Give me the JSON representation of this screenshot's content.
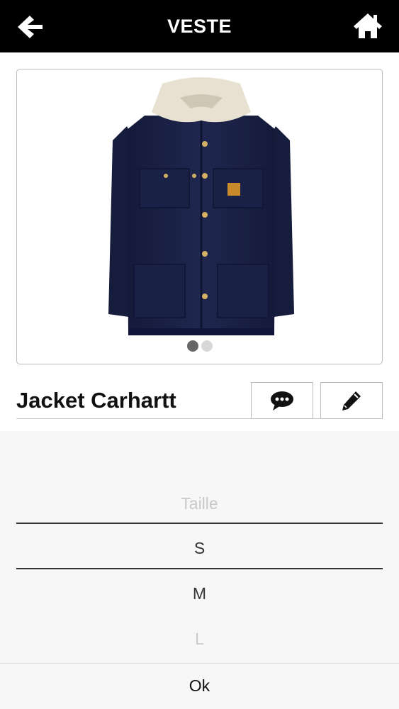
{
  "header": {
    "title": "VESTE",
    "back_icon": "arrow-left-icon",
    "home_icon": "home-icon",
    "background": "#000000",
    "text_color": "#ffffff"
  },
  "product": {
    "name": "Jacket Carhartt",
    "image": "navy-jacket-with-sherpa-collar",
    "jacket_color": "#1c2347",
    "carousel": {
      "count": 2,
      "active": 1
    }
  },
  "actions": {
    "comment_icon": "comment-icon",
    "edit_icon": "pencil-icon"
  },
  "picker": {
    "placeholder": "Taille",
    "selected": "S",
    "options": [
      "M",
      "L"
    ],
    "ok_label": "Ok"
  }
}
